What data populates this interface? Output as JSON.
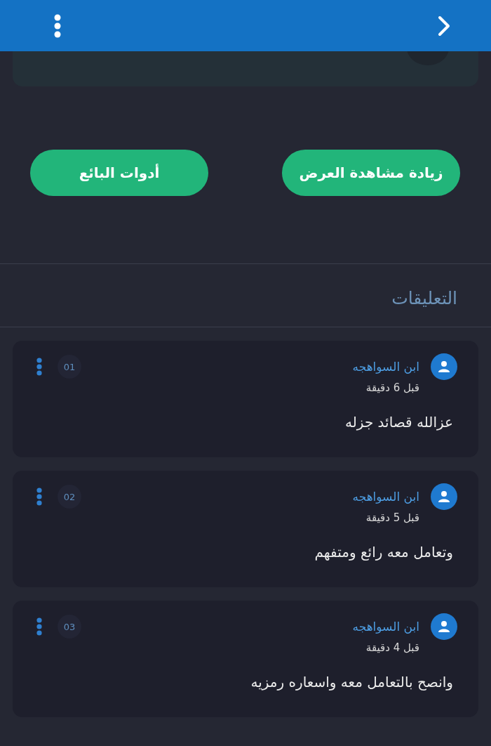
{
  "buttons": [
    {
      "label": "زيادة مشاهدة العرض"
    },
    {
      "label": "أدوات البائع"
    }
  ],
  "comments_title": "التعليقات",
  "comments": [
    {
      "author": "ابن السواهجه",
      "time": "قبل 6 دقيقة",
      "text": "عزالله قصائد جزله",
      "number": "01"
    },
    {
      "author": "ابن السواهجه",
      "time": "قبل 5 دقيقة",
      "text": "وتعامل معه رائع ومتفهم",
      "number": "02"
    },
    {
      "author": "ابن السواهجه",
      "time": "قبل 4 دقيقة",
      "text": "وانصح بالتعامل معه واسعاره رمزيه",
      "number": "03"
    }
  ]
}
